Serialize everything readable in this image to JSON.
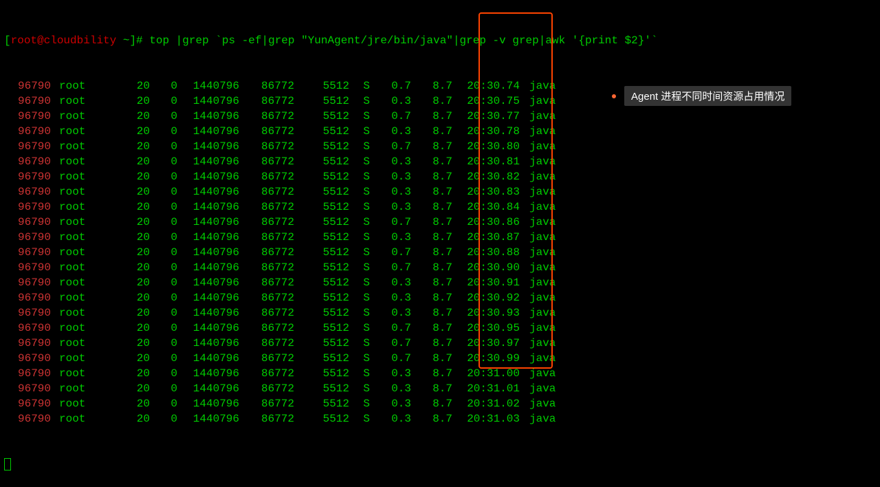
{
  "prompt": {
    "bracket_open": "[",
    "user": "root",
    "at": "@",
    "host": "cloudbility",
    "path": " ~",
    "bracket_close": "]# ",
    "command": "top |grep `ps -ef|grep \"YunAgent/jre/bin/java\"|grep -v grep|awk '{print $2}'`"
  },
  "rows": [
    {
      "pid": "96790",
      "user": "root",
      "pr": "20",
      "ni": "0",
      "virt": "1440796",
      "res": "86772",
      "shr": "5512",
      "s": "S",
      "cpu": "0.7",
      "mem": "8.7",
      "time": "20:30.74",
      "cmd": "java"
    },
    {
      "pid": "96790",
      "user": "root",
      "pr": "20",
      "ni": "0",
      "virt": "1440796",
      "res": "86772",
      "shr": "5512",
      "s": "S",
      "cpu": "0.3",
      "mem": "8.7",
      "time": "20:30.75",
      "cmd": "java"
    },
    {
      "pid": "96790",
      "user": "root",
      "pr": "20",
      "ni": "0",
      "virt": "1440796",
      "res": "86772",
      "shr": "5512",
      "s": "S",
      "cpu": "0.7",
      "mem": "8.7",
      "time": "20:30.77",
      "cmd": "java"
    },
    {
      "pid": "96790",
      "user": "root",
      "pr": "20",
      "ni": "0",
      "virt": "1440796",
      "res": "86772",
      "shr": "5512",
      "s": "S",
      "cpu": "0.3",
      "mem": "8.7",
      "time": "20:30.78",
      "cmd": "java"
    },
    {
      "pid": "96790",
      "user": "root",
      "pr": "20",
      "ni": "0",
      "virt": "1440796",
      "res": "86772",
      "shr": "5512",
      "s": "S",
      "cpu": "0.7",
      "mem": "8.7",
      "time": "20:30.80",
      "cmd": "java"
    },
    {
      "pid": "96790",
      "user": "root",
      "pr": "20",
      "ni": "0",
      "virt": "1440796",
      "res": "86772",
      "shr": "5512",
      "s": "S",
      "cpu": "0.3",
      "mem": "8.7",
      "time": "20:30.81",
      "cmd": "java"
    },
    {
      "pid": "96790",
      "user": "root",
      "pr": "20",
      "ni": "0",
      "virt": "1440796",
      "res": "86772",
      "shr": "5512",
      "s": "S",
      "cpu": "0.3",
      "mem": "8.7",
      "time": "20:30.82",
      "cmd": "java"
    },
    {
      "pid": "96790",
      "user": "root",
      "pr": "20",
      "ni": "0",
      "virt": "1440796",
      "res": "86772",
      "shr": "5512",
      "s": "S",
      "cpu": "0.3",
      "mem": "8.7",
      "time": "20:30.83",
      "cmd": "java"
    },
    {
      "pid": "96790",
      "user": "root",
      "pr": "20",
      "ni": "0",
      "virt": "1440796",
      "res": "86772",
      "shr": "5512",
      "s": "S",
      "cpu": "0.3",
      "mem": "8.7",
      "time": "20:30.84",
      "cmd": "java"
    },
    {
      "pid": "96790",
      "user": "root",
      "pr": "20",
      "ni": "0",
      "virt": "1440796",
      "res": "86772",
      "shr": "5512",
      "s": "S",
      "cpu": "0.7",
      "mem": "8.7",
      "time": "20:30.86",
      "cmd": "java"
    },
    {
      "pid": "96790",
      "user": "root",
      "pr": "20",
      "ni": "0",
      "virt": "1440796",
      "res": "86772",
      "shr": "5512",
      "s": "S",
      "cpu": "0.3",
      "mem": "8.7",
      "time": "20:30.87",
      "cmd": "java"
    },
    {
      "pid": "96790",
      "user": "root",
      "pr": "20",
      "ni": "0",
      "virt": "1440796",
      "res": "86772",
      "shr": "5512",
      "s": "S",
      "cpu": "0.7",
      "mem": "8.7",
      "time": "20:30.88",
      "cmd": "java"
    },
    {
      "pid": "96790",
      "user": "root",
      "pr": "20",
      "ni": "0",
      "virt": "1440796",
      "res": "86772",
      "shr": "5512",
      "s": "S",
      "cpu": "0.7",
      "mem": "8.7",
      "time": "20:30.90",
      "cmd": "java"
    },
    {
      "pid": "96790",
      "user": "root",
      "pr": "20",
      "ni": "0",
      "virt": "1440796",
      "res": "86772",
      "shr": "5512",
      "s": "S",
      "cpu": "0.3",
      "mem": "8.7",
      "time": "20:30.91",
      "cmd": "java"
    },
    {
      "pid": "96790",
      "user": "root",
      "pr": "20",
      "ni": "0",
      "virt": "1440796",
      "res": "86772",
      "shr": "5512",
      "s": "S",
      "cpu": "0.3",
      "mem": "8.7",
      "time": "20:30.92",
      "cmd": "java"
    },
    {
      "pid": "96790",
      "user": "root",
      "pr": "20",
      "ni": "0",
      "virt": "1440796",
      "res": "86772",
      "shr": "5512",
      "s": "S",
      "cpu": "0.3",
      "mem": "8.7",
      "time": "20:30.93",
      "cmd": "java"
    },
    {
      "pid": "96790",
      "user": "root",
      "pr": "20",
      "ni": "0",
      "virt": "1440796",
      "res": "86772",
      "shr": "5512",
      "s": "S",
      "cpu": "0.7",
      "mem": "8.7",
      "time": "20:30.95",
      "cmd": "java"
    },
    {
      "pid": "96790",
      "user": "root",
      "pr": "20",
      "ni": "0",
      "virt": "1440796",
      "res": "86772",
      "shr": "5512",
      "s": "S",
      "cpu": "0.7",
      "mem": "8.7",
      "time": "20:30.97",
      "cmd": "java"
    },
    {
      "pid": "96790",
      "user": "root",
      "pr": "20",
      "ni": "0",
      "virt": "1440796",
      "res": "86772",
      "shr": "5512",
      "s": "S",
      "cpu": "0.7",
      "mem": "8.7",
      "time": "20:30.99",
      "cmd": "java"
    },
    {
      "pid": "96790",
      "user": "root",
      "pr": "20",
      "ni": "0",
      "virt": "1440796",
      "res": "86772",
      "shr": "5512",
      "s": "S",
      "cpu": "0.3",
      "mem": "8.7",
      "time": "20:31.00",
      "cmd": "java"
    },
    {
      "pid": "96790",
      "user": "root",
      "pr": "20",
      "ni": "0",
      "virt": "1440796",
      "res": "86772",
      "shr": "5512",
      "s": "S",
      "cpu": "0.3",
      "mem": "8.7",
      "time": "20:31.01",
      "cmd": "java"
    },
    {
      "pid": "96790",
      "user": "root",
      "pr": "20",
      "ni": "0",
      "virt": "1440796",
      "res": "86772",
      "shr": "5512",
      "s": "S",
      "cpu": "0.3",
      "mem": "8.7",
      "time": "20:31.02",
      "cmd": "java"
    },
    {
      "pid": "96790",
      "user": "root",
      "pr": "20",
      "ni": "0",
      "virt": "1440796",
      "res": "86772",
      "shr": "5512",
      "s": "S",
      "cpu": "0.3",
      "mem": "8.7",
      "time": "20:31.03",
      "cmd": "java"
    }
  ],
  "annotation": {
    "text": "Agent 进程不同时间资源占用情况"
  }
}
